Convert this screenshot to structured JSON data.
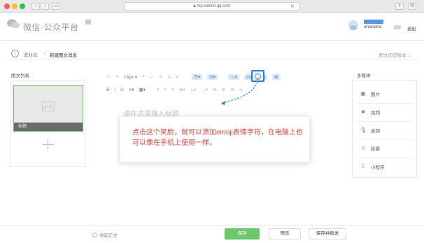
{
  "browser": {
    "url": "mp.weixin.qq.com",
    "back_icon": "chevron-left-icon",
    "forward_icon": "chevron-right-icon"
  },
  "header": {
    "app_name": "微信·公众平台",
    "username": "ahahaha",
    "logout_label": "退出"
  },
  "breadcrumb": {
    "parent": "素材库",
    "separator": "/",
    "current": "新建图文消息",
    "history_label": "图文历史版本"
  },
  "article_list": {
    "title": "图文列表",
    "cover_caption": "标题"
  },
  "toolbar": {
    "row1": [
      "↶",
      "↷",
      "16px ▾",
      "❝",
      "—",
      "✎",
      "A",
      "✐",
      "◌",
      "☰▾",
      "⊟▾",
      "☺▾",
      "⊡▾",
      "⊞",
      "⊠"
    ],
    "row2": [
      "B",
      "I",
      "U",
      "A▾",
      "▦▾",
      "⫶",
      "≡",
      "≡",
      "≡",
      "≣▾",
      "⊥▾",
      "⋮▾",
      "⫾▾",
      "⊕",
      "⊗",
      "⊙"
    ]
  },
  "editor": {
    "title_placeholder": "请在这里输入标题"
  },
  "tooltip": {
    "text": "点击这个笑脸，就可以添加emoji表情字符，在电脑上也可以像在手机上使用一样。",
    "color": "#e0433a"
  },
  "media": {
    "title": "多媒体",
    "items": [
      {
        "label": "图片",
        "icon": "image-icon"
      },
      {
        "label": "视频",
        "icon": "video-icon"
      },
      {
        "label": "音频",
        "icon": "microphone-icon"
      },
      {
        "label": "投票",
        "icon": "bar-chart-icon"
      },
      {
        "label": "小程序",
        "icon": "mini-program-icon"
      }
    ]
  },
  "footer": {
    "collapse_label": "收起正文",
    "save_label": "保存",
    "preview_label": "预览",
    "publish_label": "保存并群发",
    "accent_color": "#6cc86c"
  }
}
